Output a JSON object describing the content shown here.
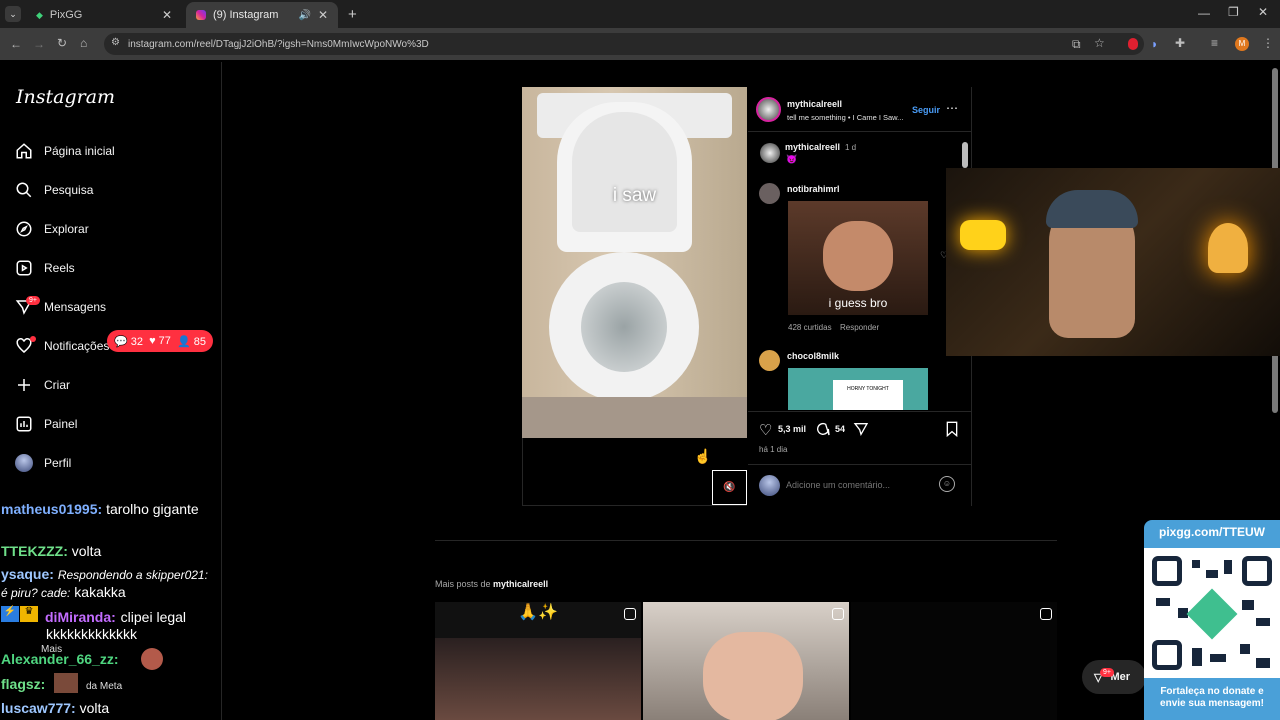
{
  "browser": {
    "tabs": [
      {
        "title": "PixGG",
        "active": false
      },
      {
        "title": "(9) Instagram",
        "active": true
      }
    ],
    "url": "instagram.com/reel/DTagjJ2iOhB/?igsh=Nms0MmIwcWpoNWo%3D",
    "profile_initial": "M"
  },
  "sidebar": {
    "logo": "Instagram",
    "items": [
      {
        "label": "Página inicial",
        "icon": "home-icon"
      },
      {
        "label": "Pesquisa",
        "icon": "search-icon"
      },
      {
        "label": "Explorar",
        "icon": "compass-icon"
      },
      {
        "label": "Reels",
        "icon": "reels-icon"
      },
      {
        "label": "Mensagens",
        "icon": "messenger-icon",
        "badge": "9+"
      },
      {
        "label": "Notificações",
        "icon": "heart-icon"
      },
      {
        "label": "Criar",
        "icon": "plus-icon"
      },
      {
        "label": "Painel",
        "icon": "dashboard-icon"
      },
      {
        "label": "Perfil",
        "icon": "avatar-icon"
      }
    ],
    "notif_pill": {
      "comments": "32",
      "likes": "77",
      "followers": "85"
    },
    "more_label": "Mais",
    "meta_label": "da Meta"
  },
  "chat": [
    {
      "user": "matheus01995:",
      "message": "tarolho gigante",
      "color": "#7fb0ff"
    },
    {
      "user": "TTEKZZZ:",
      "message": "volta",
      "color": "#6fe08a"
    },
    {
      "user": "ysaque:",
      "message": "Respondendo a skipper021: é piru? cade:",
      "extra": "kakakka",
      "color": "#9ec7ff"
    },
    {
      "user": "diMiranda:",
      "message": "clipei legal kkkkkkkkkkkkk",
      "color": "#c36cff"
    },
    {
      "user": "Alexander_66_zz:",
      "message": "",
      "color": "#4fd680"
    },
    {
      "user": "flagsz:",
      "message": "",
      "color": "#6fe08a"
    },
    {
      "user": "luscaw777:",
      "message": "volta",
      "color": "#9ec7ff"
    }
  ],
  "reel": {
    "video_caption": "i saw",
    "author": "mythicalreell",
    "follow_label": "Seguir",
    "audio": "tell me something • I Came I Saw...",
    "caption_author": "mythicalreell",
    "caption_time": "1 d",
    "comments": [
      {
        "user": "notibrahimrl",
        "gif_text": "i guess bro",
        "likes": "428 curtidas",
        "reply": "Responder"
      },
      {
        "user": "chocol8milk",
        "gif_text": "HORNY TONIGHT"
      }
    ],
    "like_count": "5,3 mil",
    "comment_count": "54",
    "posted": "há 1 dia",
    "comment_placeholder": "Adicione um comentário..."
  },
  "more_posts": {
    "prefix": "Mais posts de",
    "user": "mythicalreell",
    "first_emoji": "🙏✨"
  },
  "messages_button": {
    "label": "Mer",
    "badge": "9+"
  },
  "qr": {
    "url": "pixgg.com/TTEUW",
    "caption": "Fortaleça no donate e envie sua mensagem!"
  }
}
